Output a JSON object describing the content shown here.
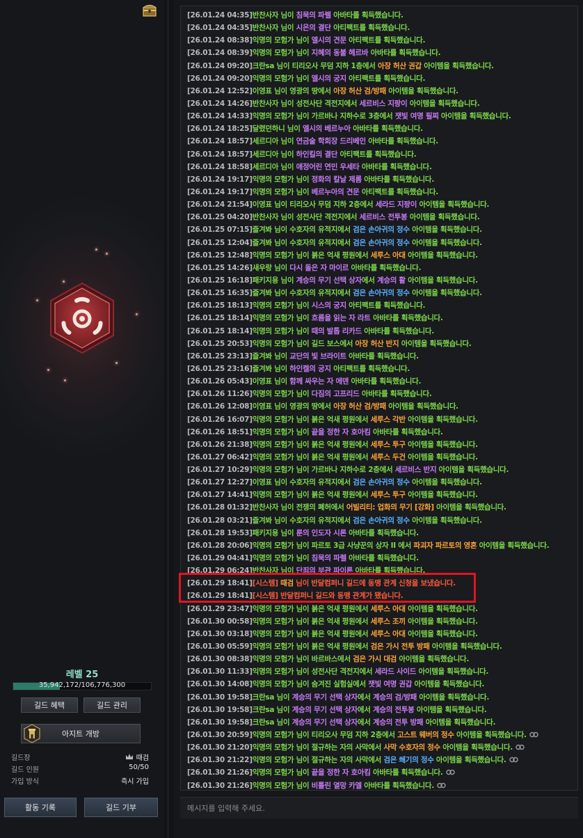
{
  "guild": {
    "level_label": "레벨 25",
    "xp_text": "35,942,172/106,776,300",
    "xp_progress": 0.3366,
    "emblem_icon": "biohazard-icon",
    "buttons": {
      "benefit": "길드 혜택",
      "manage": "길드 관리",
      "hideout": "아지트 개방",
      "activity": "활동 기록",
      "donate": "길드 기부"
    },
    "info": {
      "leader_label": "길드장",
      "leader_value": "때검",
      "members_label": "길드 인원",
      "members_value": "50/50",
      "join_label": "가입 방식",
      "join_value": "즉시 가입"
    }
  },
  "log": {
    "input_placeholder": "메시지를 입력해 주세요.",
    "lines": [
      [
        [
          "ts",
          "[26.01.24 04:35]"
        ],
        [
          "g",
          "반찬사자 님이 "
        ],
        [
          "p",
          "침묵의 파렐"
        ],
        [
          "g",
          " 아바타를 획득했습니다."
        ]
      ],
      [
        [
          "ts",
          "[26.01.24 04:35]"
        ],
        [
          "g",
          "반찬사자 님이 "
        ],
        [
          "p",
          "시온의 결단"
        ],
        [
          "g",
          "  아티팩트를 획득했습니다."
        ]
      ],
      [
        [
          "ts",
          "[26.01.24 08:38]"
        ],
        [
          "g",
          "익명의 모험가 님이 "
        ],
        [
          "p",
          "엘시의 견문"
        ],
        [
          "g",
          "  아티팩트를 획득했습니다."
        ]
      ],
      [
        [
          "ts",
          "[26.01.24 08:39]"
        ],
        [
          "g",
          "익명의 모험가 님이 "
        ],
        [
          "p",
          "지혜의 동불 헤르바"
        ],
        [
          "g",
          " 아바타를 획득했습니다."
        ]
      ],
      [
        [
          "ts",
          "[26.01.24 09:20]"
        ],
        [
          "g",
          "크란sa 님이 티리오사 무덤 지하 1층에서 "
        ],
        [
          "o",
          "아장 허산 권갑"
        ],
        [
          "g",
          " 아이템을 획득했습니다."
        ]
      ],
      [
        [
          "ts",
          "[26.01.24 09:20]"
        ],
        [
          "g",
          "익명의 모험가 님이 "
        ],
        [
          "p",
          "엘시의 궁지"
        ],
        [
          "g",
          "  아티팩트를 획득했습니다."
        ]
      ],
      [
        [
          "ts",
          "[26.01.24 12:52]"
        ],
        [
          "g",
          "이영표 님이 영광의 땅에서 "
        ],
        [
          "o",
          "아장 허산 검/방패"
        ],
        [
          "g",
          " 아이템을 획득했습니다."
        ]
      ],
      [
        [
          "ts",
          "[26.01.24 14:26]"
        ],
        [
          "g",
          "반찬사자 님이 성전사단 격전지에서 "
        ],
        [
          "p",
          "세르비스 지팡이"
        ],
        [
          "g",
          " 아이템을 획득했습니다."
        ]
      ],
      [
        [
          "ts",
          "[26.01.24 14:33]"
        ],
        [
          "g",
          "익명의 모험가 님이 가르바나 지하수로 3층에서 "
        ],
        [
          "p",
          "잿빛 여명 필찌"
        ],
        [
          "g",
          " 아이템을 획득했습니다."
        ]
      ],
      [
        [
          "ts",
          "[26.01.24 18:25]"
        ],
        [
          "g",
          "달렸던하니 님이 "
        ],
        [
          "p",
          "엘시의 베르누아"
        ],
        [
          "g",
          " 아바타를 획득했습니다."
        ]
      ],
      [
        [
          "ts",
          "[26.01.24 18:57]"
        ],
        [
          "g",
          "세르디아 님이 "
        ],
        [
          "p",
          "연금술 학회장 드리베인"
        ],
        [
          "g",
          " 아바타를 획득했습니다."
        ]
      ],
      [
        [
          "ts",
          "[26.01.24 18:57]"
        ],
        [
          "g",
          "세르디아 님이 "
        ],
        [
          "p",
          "하인킬의 결단"
        ],
        [
          "g",
          "  아티팩트를 획득했습니다."
        ]
      ],
      [
        [
          "ts",
          "[26.01.24 18:58]"
        ],
        [
          "g",
          "세르디아 님이 "
        ],
        [
          "p",
          "애정어린 연민 우세타"
        ],
        [
          "g",
          " 아바타를 획득했습니다."
        ]
      ],
      [
        [
          "ts",
          "[26.01.24 19:17]"
        ],
        [
          "g",
          "익명의 모험가 님이 "
        ],
        [
          "p",
          "정화의 칼날 제롬"
        ],
        [
          "g",
          " 아바타를 획득했습니다."
        ]
      ],
      [
        [
          "ts",
          "[26.01.24 19:17]"
        ],
        [
          "g",
          "익명의 모험가 님이 "
        ],
        [
          "p",
          "베르누아의 견문"
        ],
        [
          "g",
          "  아티팩트를 획득했습니다."
        ]
      ],
      [
        [
          "ts",
          "[26.01.24 21:54]"
        ],
        [
          "g",
          "이영표 님이 티리오사 무덤 지하 2층에서 "
        ],
        [
          "p",
          "세라드 지팡이"
        ],
        [
          "g",
          " 아이템을 획득했습니다."
        ]
      ],
      [
        [
          "ts",
          "[26.01.25 04:20]"
        ],
        [
          "g",
          "반찬사자 님이 성전사단 격전지에서 "
        ],
        [
          "p",
          "세르비스 전투봉"
        ],
        [
          "g",
          " 아이템을 획득했습니다."
        ]
      ],
      [
        [
          "ts",
          "[26.01.25 07:15]"
        ],
        [
          "g",
          "즐겨봐 님이 수호자의 유적지에서 "
        ],
        [
          "b",
          "검은 손아귀의 정수"
        ],
        [
          "g",
          " 아이템을 획득했습니다."
        ]
      ],
      [
        [
          "ts",
          "[26.01.25 12:04]"
        ],
        [
          "g",
          "즐겨봐 님이 수호자의 유적지에서 "
        ],
        [
          "b",
          "검은 손아귀의 정수"
        ],
        [
          "g",
          " 아이템을 획득했습니다."
        ]
      ],
      [
        [
          "ts",
          "[26.01.25 12:48]"
        ],
        [
          "g",
          "익명의 모험가 님이 붉은 억새 평원에서 "
        ],
        [
          "o",
          "세루스 아대"
        ],
        [
          "g",
          " 아이템을 획득했습니다."
        ]
      ],
      [
        [
          "ts",
          "[26.01.25 14:26]"
        ],
        [
          "g",
          "새우랑 님이 "
        ],
        [
          "p",
          "다시 돌은 자 마이르"
        ],
        [
          "g",
          " 아바타를 획득했습니다."
        ]
      ],
      [
        [
          "ts",
          "[26.01.25 16:18]"
        ],
        [
          "g",
          "패키지용 님이 "
        ],
        [
          "p",
          "계승의 무기 선택 상자"
        ],
        [
          "g",
          "에서 "
        ],
        [
          "p",
          "계승의 활"
        ],
        [
          "g",
          " 아이템을 획득했습니다."
        ]
      ],
      [
        [
          "ts",
          "[26.01.25 16:35]"
        ],
        [
          "g",
          "즐겨봐 님이 수호자의 유적지에서 "
        ],
        [
          "b",
          "검은 손아귀의 정수"
        ],
        [
          "g",
          " 아이템을 획득했습니다."
        ]
      ],
      [
        [
          "ts",
          "[26.01.25 18:13]"
        ],
        [
          "g",
          "익명의 모험가 님이 "
        ],
        [
          "p",
          "시스의 궁지"
        ],
        [
          "g",
          "  아티팩트를 획득했습니다."
        ]
      ],
      [
        [
          "ts",
          "[26.01.25 18:14]"
        ],
        [
          "g",
          "익명의 모험가 님이 "
        ],
        [
          "p",
          "흐름을 읽는 자 라트"
        ],
        [
          "g",
          " 아바타를 획득했습니다."
        ]
      ],
      [
        [
          "ts",
          "[26.01.25 18:14]"
        ],
        [
          "g",
          "익명의 모험가 님이 "
        ],
        [
          "p",
          "때의 발톱 리카드"
        ],
        [
          "g",
          " 아바타를 획득했습니다."
        ]
      ],
      [
        [
          "ts",
          "[26.01.25 20:53]"
        ],
        [
          "g",
          "익명의 모험가 님이 길드 보스에서 "
        ],
        [
          "o",
          "아장 허산 반지"
        ],
        [
          "g",
          " 아이템을 획득했습니다."
        ]
      ],
      [
        [
          "ts",
          "[26.01.25 23:13]"
        ],
        [
          "g",
          "즐겨봐 님이 "
        ],
        [
          "p",
          "교단의 빛 브라이트"
        ],
        [
          "g",
          " 아바타를 획득했습니다."
        ]
      ],
      [
        [
          "ts",
          "[26.01.25 23:16]"
        ],
        [
          "g",
          "즐겨봐 님이 "
        ],
        [
          "p",
          "하인켈의 궁지"
        ],
        [
          "g",
          "  아티팩트를 획득했습니다."
        ]
      ],
      [
        [
          "ts",
          "[26.01.26 05:43]"
        ],
        [
          "g",
          "이영표 님이 "
        ],
        [
          "p",
          "함께 싸우는 자 에덴"
        ],
        [
          "g",
          " 아바타를 획득했습니다."
        ]
      ],
      [
        [
          "ts",
          "[26.01.26 11:26]"
        ],
        [
          "g",
          "익명의 모험가 님이 "
        ],
        [
          "p",
          "다짐의 고프리드"
        ],
        [
          "g",
          " 아바타를 획득했습니다."
        ]
      ],
      [
        [
          "ts",
          "[26.01.26 12:08]"
        ],
        [
          "g",
          "이영표 님이 영광의 땅에서 "
        ],
        [
          "o",
          "아장 허산 검/방패"
        ],
        [
          "g",
          " 아이템을 획득했습니다."
        ]
      ],
      [
        [
          "ts",
          "[26.01.26 16:07]"
        ],
        [
          "g",
          "익명의 모험가 님이 붉은 억새 평원에서 "
        ],
        [
          "o",
          "세루스 각반"
        ],
        [
          "g",
          " 아이템을 획득했습니다."
        ]
      ],
      [
        [
          "ts",
          "[26.01.26 18:51]"
        ],
        [
          "g",
          "익명의 모험가 님이 "
        ],
        [
          "p",
          "끝을 정한 자 호아킴"
        ],
        [
          "g",
          " 아바타를 획득했습니다."
        ]
      ],
      [
        [
          "ts",
          "[26.01.26 21:38]"
        ],
        [
          "g",
          "익명의 모험가 님이 붉은 억새 평원에서 "
        ],
        [
          "o",
          "세루스 투구"
        ],
        [
          "g",
          " 아이템을 획득했습니다."
        ]
      ],
      [
        [
          "ts",
          "[26.01.27 06:42]"
        ],
        [
          "g",
          "익명의 모험가 님이 붉은 억새 평원에서 "
        ],
        [
          "o",
          "세루스 두건"
        ],
        [
          "g",
          " 아이템을 획득했습니다."
        ]
      ],
      [
        [
          "ts",
          "[26.01.27 10:29]"
        ],
        [
          "g",
          "익명의 모험가 님이 가르바나 지하수로 2층에서 "
        ],
        [
          "p",
          "세르비스 반지"
        ],
        [
          "g",
          " 아이템을 획득했습니다."
        ]
      ],
      [
        [
          "ts",
          "[26.01.27 12:27]"
        ],
        [
          "g",
          "이영표 님이 수호자의 유적지에서 "
        ],
        [
          "b",
          "검은 손아귀의 정수"
        ],
        [
          "g",
          " 아이템을 획득했습니다."
        ]
      ],
      [
        [
          "ts",
          "[26.01.27 14:41]"
        ],
        [
          "g",
          "익명의 모험가 님이 붉은 억새 평원에서 "
        ],
        [
          "o",
          "세루스 투구"
        ],
        [
          "g",
          " 아이템을 획득했습니다."
        ]
      ],
      [
        [
          "ts",
          "[26.01.28 01:32]"
        ],
        [
          "g",
          "반찬사자 님이 전쟁의 폐허에서 "
        ],
        [
          "o",
          "어빌리티: 업화의 무기 [강화]"
        ],
        [
          "g",
          " 아이템을 획득했습니다."
        ]
      ],
      [
        [
          "ts",
          "[26.01.28 03:21]"
        ],
        [
          "g",
          "즐겨봐 님이 수호자의 유적지에서 "
        ],
        [
          "b",
          "검은 손아귀의 정수"
        ],
        [
          "g",
          " 아이템을 획득했습니다."
        ]
      ],
      [
        [
          "ts",
          "[26.01.28 19:53]"
        ],
        [
          "g",
          "패키지용 님이 "
        ],
        [
          "p",
          "룬의 인도자 시론"
        ],
        [
          "g",
          " 아바타를 획득했습니다."
        ]
      ],
      [
        [
          "ts",
          "[26.01.28 20:06]"
        ],
        [
          "g",
          "익명의 모험가 님이 파르토 3급 사냥꾼의 상자 II 에서 "
        ],
        [
          "o",
          "파괴자 파르토의 영혼"
        ],
        [
          "g",
          " 아이템을 획득했습니다."
        ]
      ],
      [
        [
          "ts",
          "[26.01.29 04:41]"
        ],
        [
          "g",
          "익명의 모험가 님이 "
        ],
        [
          "p",
          "침묵의 파렐"
        ],
        [
          "g",
          " 아바타를 획득했습니다."
        ]
      ],
      [
        [
          "ts",
          "[26.01.29 06:24]"
        ],
        [
          "g",
          "반찬사자 님이 "
        ],
        [
          "p",
          "단죄의 부관 파이론"
        ],
        [
          "g",
          " 아바타를 획득했습니다."
        ]
      ],
      [
        [
          "ts",
          "[26.01.29 18:41]"
        ],
        [
          "r",
          "[시스템] "
        ],
        [
          "o",
          "때검"
        ],
        [
          "r",
          " 님이 반달컴퍼니 길드에 동맹 관계 신청을 보냈습니다."
        ]
      ],
      [
        [
          "ts",
          "[26.01.29 18:41]"
        ],
        [
          "r",
          "[시스템] 반달컴퍼니 길드와 동맹 관계가 됐습니다."
        ]
      ],
      [
        [
          "ts",
          "[26.01.29 23:47]"
        ],
        [
          "g",
          "익명의 모험가 님이 붉은 억새 평원에서 "
        ],
        [
          "o",
          "세루스 아대"
        ],
        [
          "g",
          " 아이템을 획득했습니다."
        ]
      ],
      [
        [
          "ts",
          "[26.01.30 00:58]"
        ],
        [
          "g",
          "익명의 모험가 님이 붉은 억새 평원에서 "
        ],
        [
          "o",
          "세루스 조끼"
        ],
        [
          "g",
          " 아이템을 획득했습니다."
        ]
      ],
      [
        [
          "ts",
          "[26.01.30 03:18]"
        ],
        [
          "g",
          "익명의 모험가 님이 붉은 억새 평원에서 "
        ],
        [
          "o",
          "세루스 아대"
        ],
        [
          "g",
          " 아이템을 획득했습니다."
        ]
      ],
      [
        [
          "ts",
          "[26.01.30 05:59]"
        ],
        [
          "g",
          "익명의 모험가 님이 붉은 억새 평원에서 "
        ],
        [
          "o",
          "검은 가시 전투 방패"
        ],
        [
          "g",
          " 아이템을 획득했습니다."
        ]
      ],
      [
        [
          "ts",
          "[26.01.30 08:38]"
        ],
        [
          "g",
          "익명의 모험가 님이 바르바스에서 "
        ],
        [
          "o",
          "검은 가시 대검"
        ],
        [
          "g",
          " 아이템을 획득했습니다."
        ]
      ],
      [
        [
          "ts",
          "[26.01.30 11:33]"
        ],
        [
          "g",
          "익명의 모험가 님이 성전사단 격전지에서 "
        ],
        [
          "p",
          "세라드 사이드"
        ],
        [
          "g",
          " 아이템을 획득했습니다."
        ]
      ],
      [
        [
          "ts",
          "[26.01.30 14:08]"
        ],
        [
          "g",
          "익명의 모험가 님이 숨겨진 실험실에서 "
        ],
        [
          "p",
          "잿빛 여명 권갑"
        ],
        [
          "g",
          " 아이템을 획득했습니다."
        ]
      ],
      [
        [
          "ts",
          "[26.01.30 19:58]"
        ],
        [
          "g",
          "크란sa 님이 "
        ],
        [
          "p",
          "계승의 무기 선택 상자"
        ],
        [
          "g",
          "에서 "
        ],
        [
          "p",
          "계승의 검/방패"
        ],
        [
          "g",
          " 아이템을 획득했습니다."
        ]
      ],
      [
        [
          "ts",
          "[26.01.30 19:58]"
        ],
        [
          "g",
          "크란sa 님이 "
        ],
        [
          "p",
          "계승의 무기 선택 상자"
        ],
        [
          "g",
          "에서 "
        ],
        [
          "p",
          "계승의 전투봉"
        ],
        [
          "g",
          " 아이템을 획득했습니다."
        ]
      ],
      [
        [
          "ts",
          "[26.01.30 19:58]"
        ],
        [
          "g",
          "크란sa 님이 "
        ],
        [
          "p",
          "계승의 무기 선택 상자"
        ],
        [
          "g",
          "에서 "
        ],
        [
          "p",
          "계승의 전투 방패"
        ],
        [
          "g",
          " 아이템을 획득했습니다."
        ]
      ],
      [
        [
          "ts",
          "[26.01.30 20:59]"
        ],
        [
          "g",
          "익명의 모험가 님이 티리오사 무덤 지하 2층에서 "
        ],
        [
          "o",
          "고스트 웨버의 정수"
        ],
        [
          "g",
          " 아이템을 획득했습니다."
        ],
        [
          "lk",
          ""
        ]
      ],
      [
        [
          "ts",
          "[26.01.30 21:20]"
        ],
        [
          "g",
          "익명의 모험가 님이 절규하는 자의 사막에서 "
        ],
        [
          "o",
          "사막 수호자의 정수"
        ],
        [
          "g",
          " 아이템을 획득했습니다."
        ],
        [
          "lk",
          ""
        ]
      ],
      [
        [
          "ts",
          "[26.01.30 21:22]"
        ],
        [
          "g",
          "익명의 모험가 님이 절규하는 자의 사막에서 "
        ],
        [
          "b",
          "검은 쐐기의 정수"
        ],
        [
          "g",
          " 아이템을 획득했습니다."
        ],
        [
          "lk",
          ""
        ]
      ],
      [
        [
          "ts",
          "[26.01.30 21:26]"
        ],
        [
          "g",
          "익명의 모험가 님이 "
        ],
        [
          "p",
          "끝을 정한 자 호아킴"
        ],
        [
          "g",
          " 아바타를 획득했습니다."
        ],
        [
          "lk",
          ""
        ]
      ],
      [
        [
          "ts",
          "[26.01.30 21:26]"
        ],
        [
          "g",
          "익명의 모험가 님이 "
        ],
        [
          "p",
          "비틀린 열망 카엘"
        ],
        [
          "g",
          " 아바타를 획득했습니다."
        ],
        [
          "lk",
          ""
        ]
      ]
    ]
  }
}
